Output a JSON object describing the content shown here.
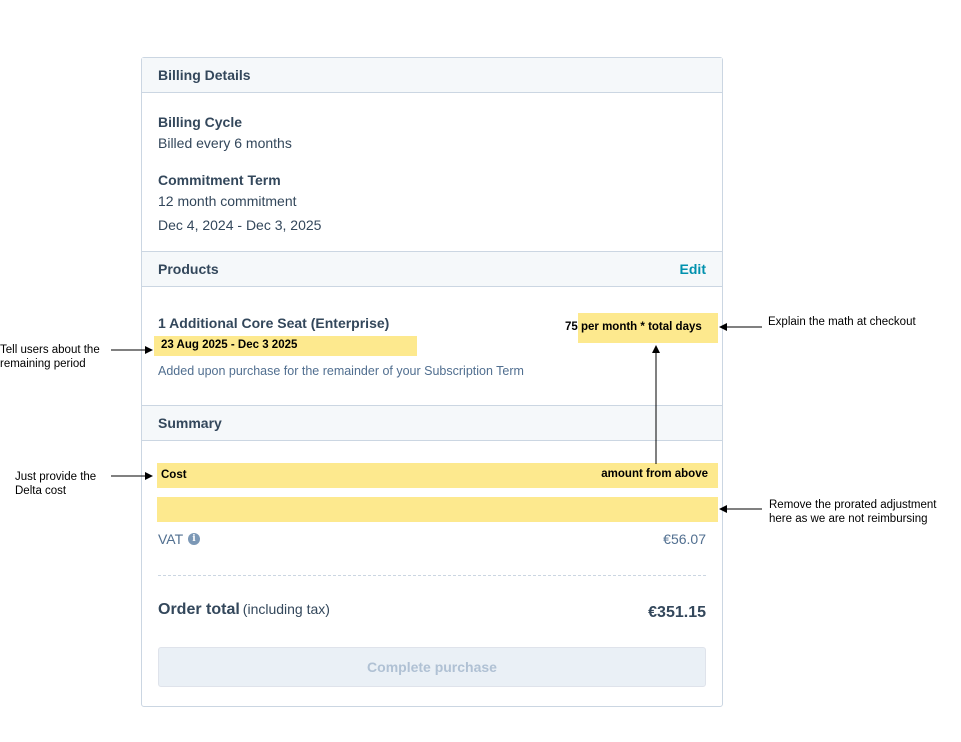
{
  "billing_details": {
    "header": "Billing Details",
    "billing_cycle_label": "Billing Cycle",
    "billing_cycle_value": "Billed every 6 months",
    "commitment_label": "Commitment Term",
    "commitment_value": "12 month commitment",
    "commitment_dates": "Dec 4, 2024 - Dec 3, 2025"
  },
  "products": {
    "header": "Products",
    "edit_label": "Edit",
    "item_name": "1 Additional Core Seat (Enterprise)",
    "item_period": "23 Aug  2025 - Dec 3 2025",
    "item_price_note": "75 per month * total days",
    "item_description": "Added upon purchase for the remainder of your Subscription Term"
  },
  "summary": {
    "header": "Summary",
    "cost_label": "Cost",
    "cost_value": "amount from above",
    "vat_label": "VAT",
    "vat_value": "€56.07",
    "order_total_label": "Order total",
    "order_total_sub": "(including tax)",
    "order_total_value": "€351.15",
    "purchase_button": "Complete purchase"
  },
  "annotations": {
    "remaining_period": "Tell users about the remaining period",
    "explain_math": "Explain the math at checkout",
    "delta_cost": "Just provide the Delta cost",
    "remove_prorated": "Remove the prorated adjustment here as we are not reimbursing"
  },
  "colors": {
    "highlight": "#fde98e",
    "accent_link": "#0091ae",
    "text_primary": "#33475b",
    "header_bg": "#f5f8fa",
    "border": "#cbd6e2"
  },
  "icons": {
    "vat_info": "info-circle-icon"
  }
}
